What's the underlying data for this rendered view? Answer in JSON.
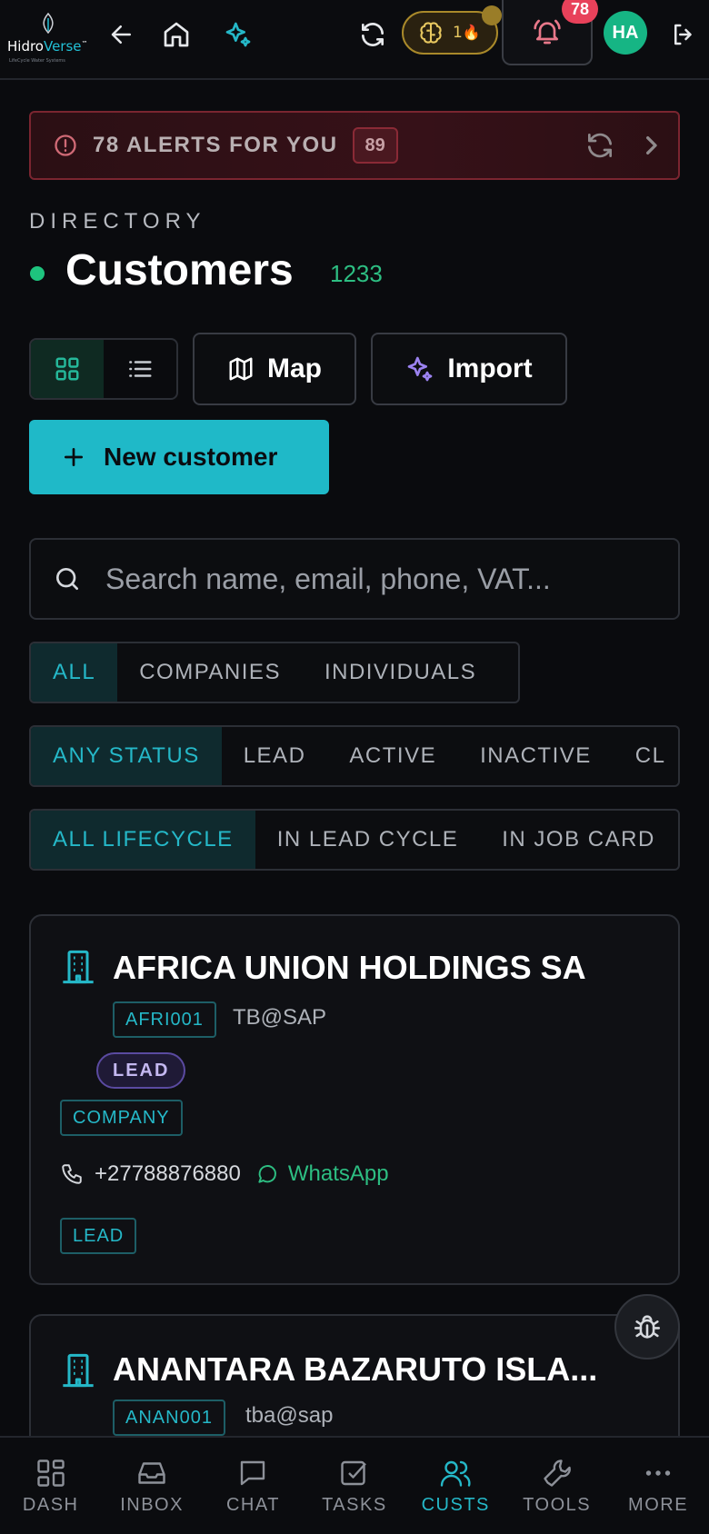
{
  "app": {
    "brand_prefix": "Hidro",
    "brand_suffix": "Verse",
    "brand_mark": "™",
    "tagline": "LifeCycle Water Systems"
  },
  "topbar": {
    "streak_count": "1",
    "streak_emoji": "🔥",
    "notifications_count": "78",
    "avatar_initials": "HA"
  },
  "alerts": {
    "label": "78 ALERTS FOR YOU",
    "count": "89"
  },
  "header": {
    "eyebrow": "DIRECTORY",
    "title": "Customers",
    "count": "1233"
  },
  "actions": {
    "map_label": "Map",
    "import_label": "Import",
    "new_label": "New customer"
  },
  "search": {
    "placeholder": "Search name, email, phone, VAT..."
  },
  "filters": {
    "type": [
      "ALL",
      "COMPANIES",
      "INDIVIDUALS"
    ],
    "status": [
      "ANY STATUS",
      "LEAD",
      "ACTIVE",
      "INACTIVE",
      "CL"
    ],
    "lifecycle": [
      "ALL LIFECYCLE",
      "IN LEAD CYCLE",
      "IN JOB CARD"
    ]
  },
  "customers": [
    {
      "name": "AFRICA UNION HOLDINGS SA",
      "code": "AFRI001",
      "email": "TB@SAP",
      "status": "LEAD",
      "kind": "COMPANY",
      "phone": "+27788876880",
      "whatsapp": "WhatsApp",
      "stage": "LEAD"
    },
    {
      "name": "ANANTARA BAZARUTO ISLA...",
      "code": "ANAN001",
      "email": "tba@sap"
    }
  ],
  "bottom_nav": [
    "DASH",
    "INBOX",
    "CHAT",
    "TASKS",
    "CUSTS",
    "TOOLS",
    "MORE"
  ],
  "colors": {
    "accent": "#1fb9c8",
    "success": "#2dbe82",
    "danger": "#e8415a",
    "lead": "#c4b8f0"
  }
}
